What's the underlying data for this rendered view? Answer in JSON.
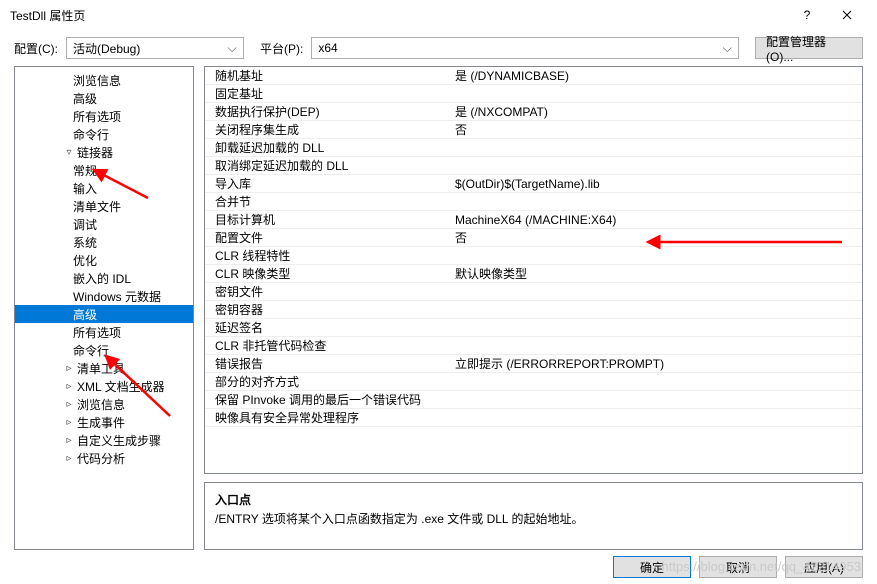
{
  "window": {
    "title": "TestDll 属性页"
  },
  "toolbar": {
    "config_label": "配置(C):",
    "config_value": "活动(Debug)",
    "platform_label": "平台(P):",
    "platform_value": "x64",
    "manager_button": "配置管理器(O)..."
  },
  "tree": [
    {
      "label": "浏览信息",
      "indent": 3,
      "exp": ""
    },
    {
      "label": "高级",
      "indent": 3,
      "exp": ""
    },
    {
      "label": "所有选项",
      "indent": 3,
      "exp": ""
    },
    {
      "label": "命令行",
      "indent": 3,
      "exp": ""
    },
    {
      "label": "链接器",
      "indent": 2,
      "exp": "▿"
    },
    {
      "label": "常规",
      "indent": 3,
      "exp": ""
    },
    {
      "label": "输入",
      "indent": 3,
      "exp": ""
    },
    {
      "label": "清单文件",
      "indent": 3,
      "exp": ""
    },
    {
      "label": "调试",
      "indent": 3,
      "exp": ""
    },
    {
      "label": "系统",
      "indent": 3,
      "exp": ""
    },
    {
      "label": "优化",
      "indent": 3,
      "exp": ""
    },
    {
      "label": "嵌入的 IDL",
      "indent": 3,
      "exp": ""
    },
    {
      "label": "Windows 元数据",
      "indent": 3,
      "exp": ""
    },
    {
      "label": "高级",
      "indent": 3,
      "exp": "",
      "selected": true
    },
    {
      "label": "所有选项",
      "indent": 3,
      "exp": ""
    },
    {
      "label": "命令行",
      "indent": 3,
      "exp": ""
    },
    {
      "label": "清单工具",
      "indent": 2,
      "exp": "▹"
    },
    {
      "label": "XML 文档生成器",
      "indent": 2,
      "exp": "▹"
    },
    {
      "label": "浏览信息",
      "indent": 2,
      "exp": "▹"
    },
    {
      "label": "生成事件",
      "indent": 2,
      "exp": "▹"
    },
    {
      "label": "自定义生成步骤",
      "indent": 2,
      "exp": "▹"
    },
    {
      "label": "代码分析",
      "indent": 2,
      "exp": "▹"
    }
  ],
  "grid": [
    {
      "label": "随机基址",
      "value": "是 (/DYNAMICBASE)"
    },
    {
      "label": "固定基址",
      "value": ""
    },
    {
      "label": "数据执行保护(DEP)",
      "value": "是 (/NXCOMPAT)"
    },
    {
      "label": "关闭程序集生成",
      "value": "否"
    },
    {
      "label": "卸载延迟加载的 DLL",
      "value": ""
    },
    {
      "label": "取消绑定延迟加载的 DLL",
      "value": ""
    },
    {
      "label": "导入库",
      "value": "$(OutDir)$(TargetName).lib"
    },
    {
      "label": "合并节",
      "value": ""
    },
    {
      "label": "目标计算机",
      "value": "MachineX64 (/MACHINE:X64)"
    },
    {
      "label": "配置文件",
      "value": "否"
    },
    {
      "label": "CLR 线程特性",
      "value": ""
    },
    {
      "label": "CLR 映像类型",
      "value": "默认映像类型"
    },
    {
      "label": "密钥文件",
      "value": ""
    },
    {
      "label": "密钥容器",
      "value": ""
    },
    {
      "label": "延迟签名",
      "value": ""
    },
    {
      "label": "CLR 非托管代码检查",
      "value": ""
    },
    {
      "label": "错误报告",
      "value": "立即提示 (/ERRORREPORT:PROMPT)"
    },
    {
      "label": "部分的对齐方式",
      "value": ""
    },
    {
      "label": "保留 PInvoke 调用的最后一个错误代码",
      "value": ""
    },
    {
      "label": "映像具有安全异常处理程序",
      "value": ""
    }
  ],
  "description": {
    "header": "入口点",
    "body": "/ENTRY 选项将某个入口点函数指定为 .exe 文件或 DLL 的起始地址。"
  },
  "footer": {
    "ok": "确定",
    "cancel": "取消",
    "apply": "应用(A)"
  },
  "watermark": "https://blog.csdn.net/qq_42214953"
}
